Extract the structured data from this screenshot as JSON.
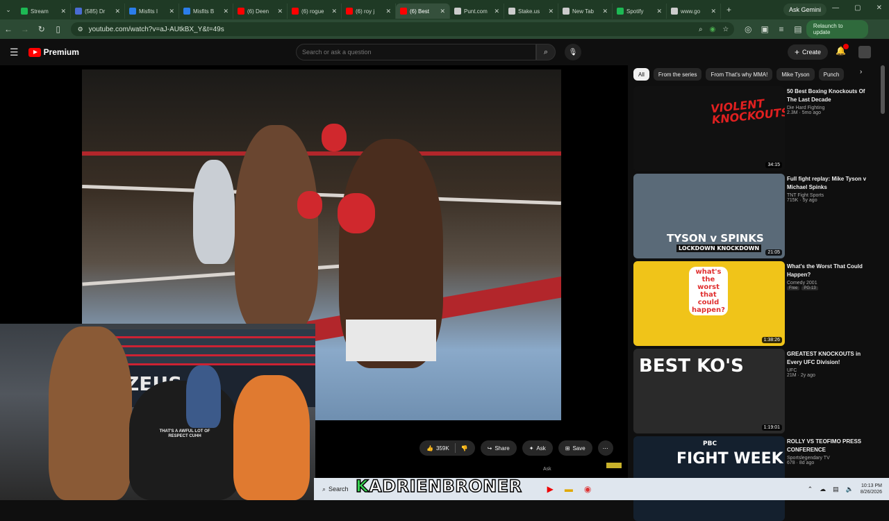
{
  "browser": {
    "tabs": [
      {
        "label": "Stream",
        "color": "#1db954",
        "active": false
      },
      {
        "label": "(585) Dr",
        "color": "#4a6cd4",
        "active": false
      },
      {
        "label": "Misfits I",
        "color": "#2b7de9",
        "active": false
      },
      {
        "label": "Misfits B",
        "color": "#2b7de9",
        "active": false
      },
      {
        "label": "(6) Deen",
        "color": "#ff0000",
        "active": false
      },
      {
        "label": "(6) rogue",
        "color": "#ff0000",
        "active": false
      },
      {
        "label": "(6) roy j",
        "color": "#ff0000",
        "active": false
      },
      {
        "label": "(6) Best",
        "color": "#ff0000",
        "active": true
      },
      {
        "label": "Punt.com",
        "color": "#cccccc",
        "active": false
      },
      {
        "label": "Stake.us",
        "color": "#cccccc",
        "active": false
      },
      {
        "label": "New Tab",
        "color": "#cccccc",
        "active": false
      },
      {
        "label": "Spotify",
        "color": "#1db954",
        "active": false
      },
      {
        "label": "www.go",
        "color": "#cccccc",
        "active": false
      }
    ],
    "ask_gemini": "Ask Gemini",
    "url": "youtube.com/watch?v=aJ-AUtkBX_Y&t=49s",
    "relaunch": "Relaunch to update"
  },
  "youtube": {
    "logo_text": "Premium",
    "search_placeholder": "Search or ask a question",
    "create_label": "Create"
  },
  "actions": {
    "likes": "359K",
    "share": "Share",
    "ask": "Ask",
    "save": "Save",
    "ask_tooltip": "Ask"
  },
  "chips": [
    "All",
    "From the series",
    "From That's why MMA!",
    "Mike Tyson",
    "Punch"
  ],
  "recommendations": [
    {
      "title": "50 Best Boxing Knockouts Of The Last Decade",
      "channel": "Die Hard Fighting",
      "stats": "2.3M · 5mo ago",
      "duration": "34:15",
      "thumb_text": "VIOLENT KNOCKOUTS",
      "bg": "#111111",
      "accent": "#e02020"
    },
    {
      "title": "Full fight replay: Mike Tyson v Michael Spinks",
      "channel": "TNT Fight Sports",
      "stats": "715K · 5y ago",
      "duration": "21:05",
      "thumb_text": "TYSON v SPINKS",
      "thumb_sub": "LOCKDOWN KNOCKDOWN",
      "bg": "#5a6a78",
      "accent": "#ffffff"
    },
    {
      "title": "What's the Worst That Could Happen?",
      "channel": "Comedy 2001",
      "stats": "",
      "badges": [
        "Free",
        "PG-13"
      ],
      "duration": "1:38:26",
      "thumb_text": "what's the worst that could happen?",
      "bg": "#f0c419",
      "accent": "#e03030"
    },
    {
      "title": "GREATEST KNOCKOUTS in Every UFC Division!",
      "channel": "UFC",
      "stats": "21M · 2y ago",
      "duration": "1:19:01",
      "thumb_text": "BEST KO'S",
      "bg": "#2a2a2a",
      "accent": "#ffffff"
    },
    {
      "title": "ROLLY VS TEOFIMO PRESS CONFERENCE",
      "channel": "Sportslegendary TV",
      "stats": "678 · 8d ago",
      "duration": "",
      "thumb_text": "FIGHT WEEK",
      "thumb_sub": "PBC",
      "bg": "#14202e",
      "accent": "#ffffff"
    }
  ],
  "overlay": {
    "watermark_k": "K",
    "watermark_rest": "ADRIENBRONER",
    "shirt_text": "THAT'S A AWFUL LOT OF RESPECT CUHH",
    "banner_text": "ZEUS"
  },
  "taskbar": {
    "search_label": "Search",
    "time": "10:13 PM",
    "date": "8/26/2026"
  }
}
